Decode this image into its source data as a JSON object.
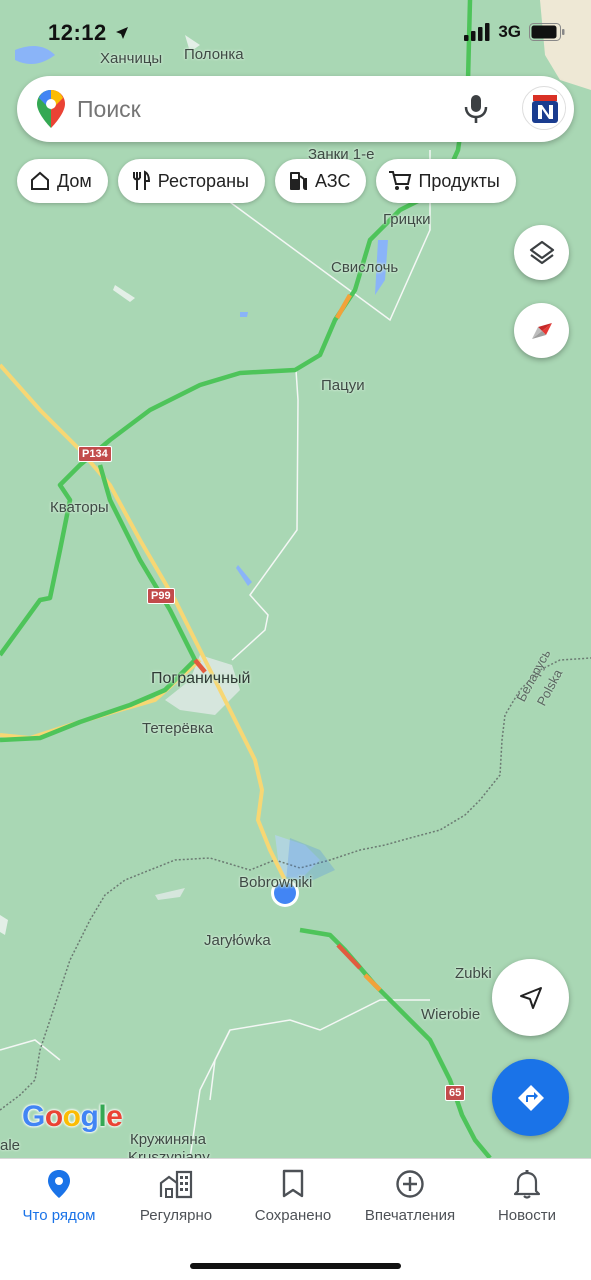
{
  "status_bar": {
    "time": "12:12",
    "network": "3G"
  },
  "search": {
    "placeholder": "Поиск"
  },
  "chips": [
    {
      "label": "Дом",
      "icon": "home-icon"
    },
    {
      "label": "Рестораны",
      "icon": "restaurant-icon"
    },
    {
      "label": "АЗС",
      "icon": "gas-station-icon"
    },
    {
      "label": "Продукты",
      "icon": "cart-icon"
    }
  ],
  "map": {
    "labels": {
      "khanchitsy": "Ханчицы",
      "polonka": "Полонка",
      "zanki": "Занки 1-е",
      "gritski": "Грицки",
      "svisloch": "Свислочь",
      "patsui": "Пацуи",
      "kvatory": "Кваторы",
      "pogranichny": "Пограничный",
      "teterevka": "Тетерёвка",
      "bobrowniki": "Bobrowniki",
      "jarylowka": "Jaryłówka",
      "zubki": "Zubki",
      "wierobie": "Wierobie",
      "kruzhinyana": "Кружиняна",
      "kruszyniany": "Kruszyniany",
      "edge_left": "ale"
    },
    "border_labels": {
      "belarus": "Беларусь",
      "polska": "Polska"
    },
    "road_shields": {
      "p134": "P134",
      "p99": "P99",
      "r65": "65"
    },
    "colors": {
      "land": "#a9d7b4",
      "traffic_green": "#4ec45a",
      "traffic_orange": "#f2a23b",
      "traffic_red": "#e25b3f",
      "road_yellow": "#f7d774",
      "location_blue": "#4285f4"
    }
  },
  "logo": "Google",
  "bottom_nav": [
    {
      "label": "Что рядом",
      "icon": "location-pin-icon",
      "active": true
    },
    {
      "label": "Регулярно",
      "icon": "commute-icon",
      "active": false
    },
    {
      "label": "Сохранено",
      "icon": "bookmark-icon",
      "active": false
    },
    {
      "label": "Впечатления",
      "icon": "add-circle-icon",
      "active": false
    },
    {
      "label": "Новости",
      "icon": "bell-icon",
      "active": false
    }
  ]
}
